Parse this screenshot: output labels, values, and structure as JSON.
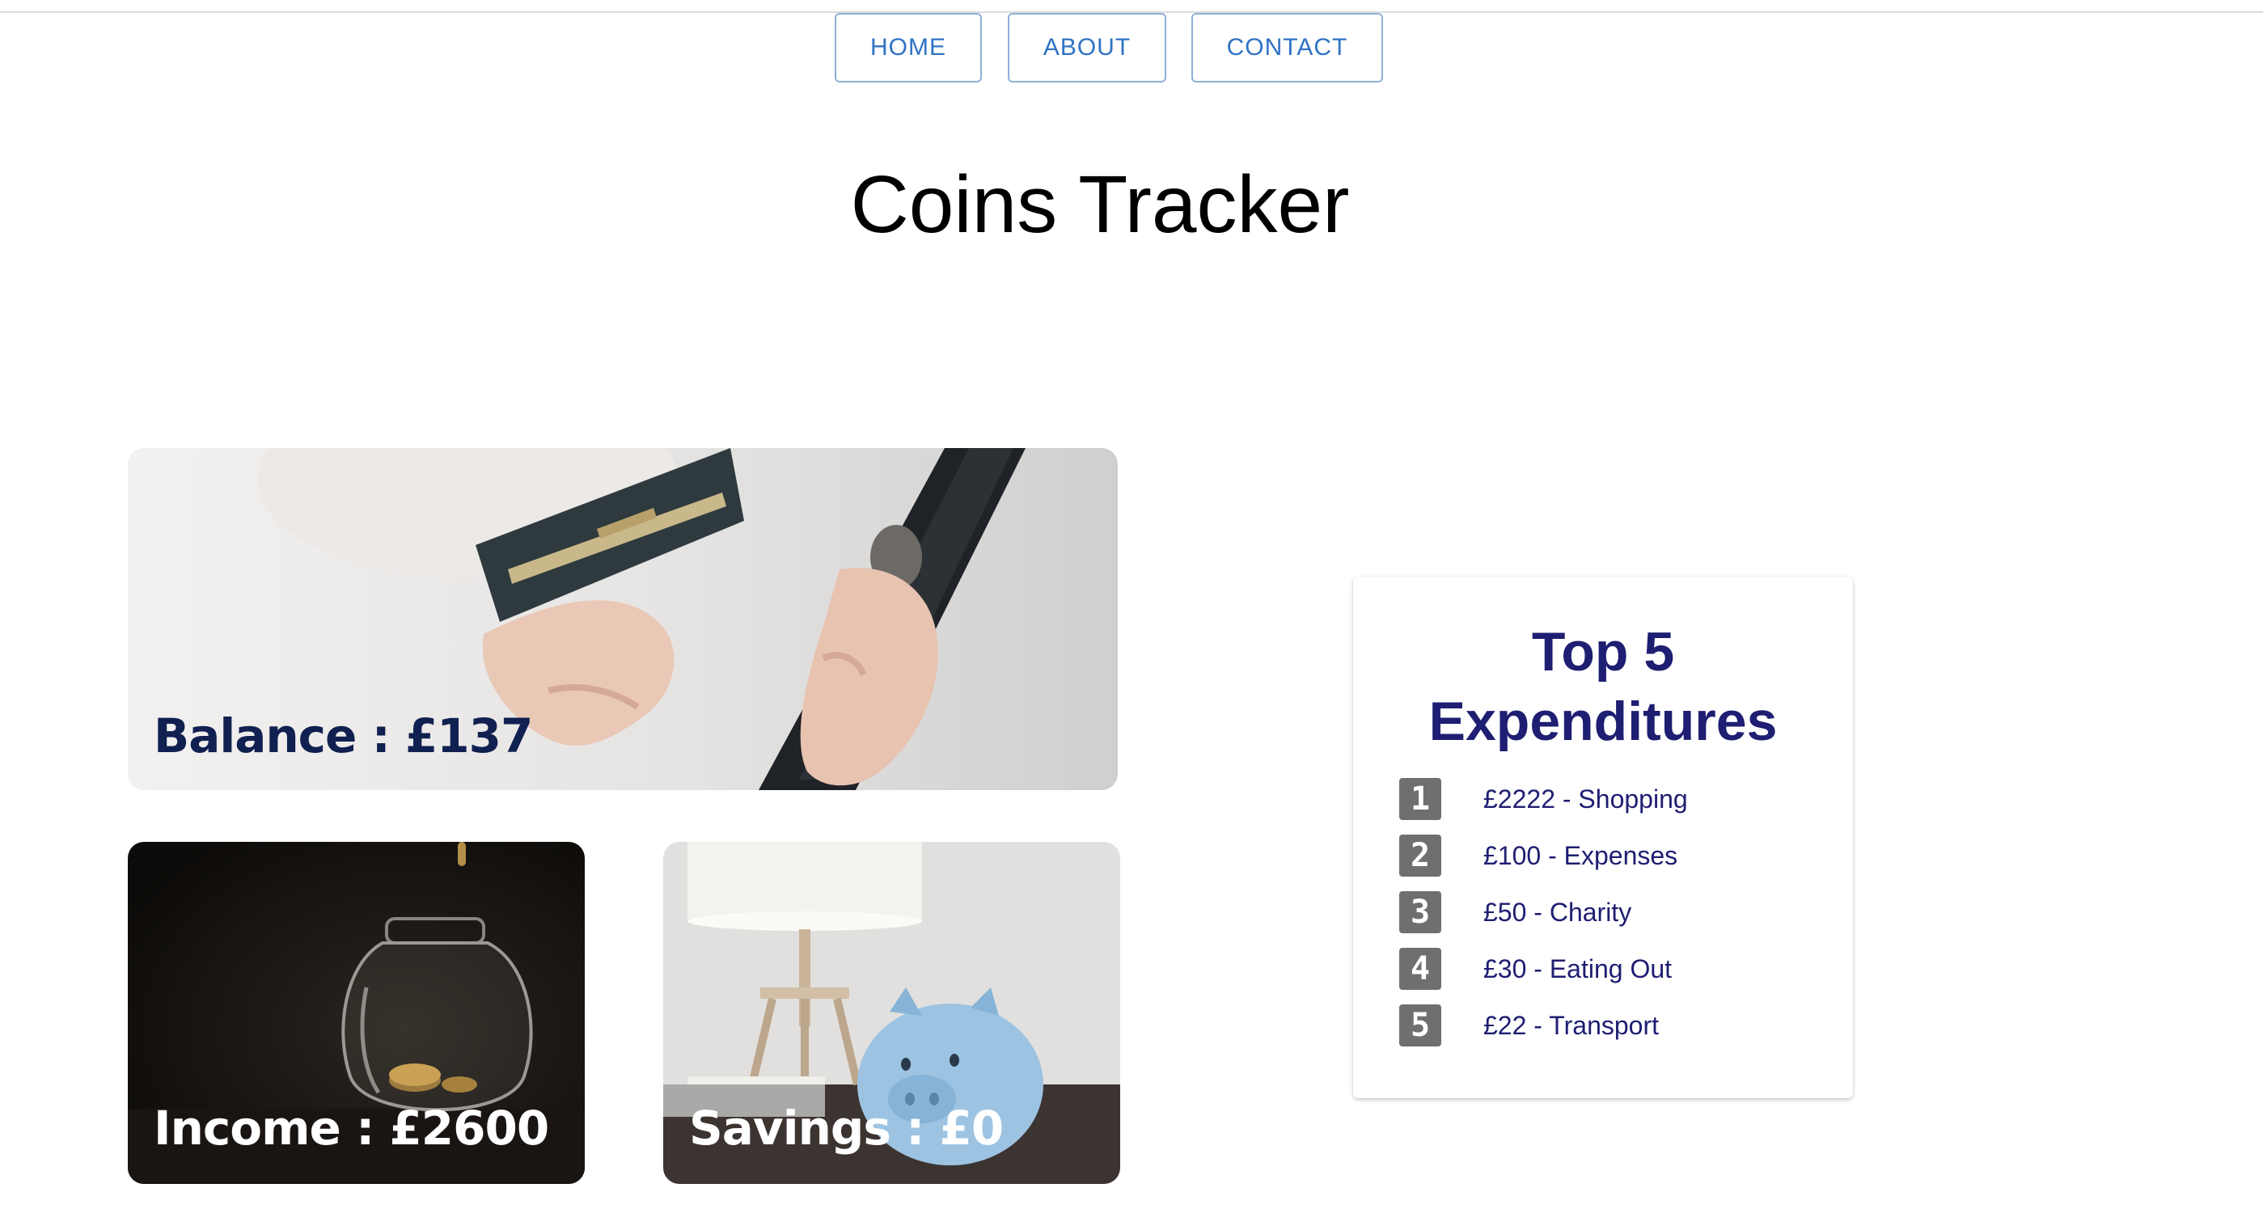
{
  "nav": {
    "home": "HOME",
    "about": "ABOUT",
    "contact": "CONTACT"
  },
  "page": {
    "title": "Coins Tracker"
  },
  "cards": {
    "balance": "Balance : £137",
    "income": "Income : £2600",
    "savings": "Savings : £0"
  },
  "top5": {
    "title_line1": "Top 5",
    "title_line2": "Expenditures",
    "items": [
      {
        "rank": "1",
        "text": "£2222 - Shopping"
      },
      {
        "rank": "2",
        "text": "£100 - Expenses"
      },
      {
        "rank": "3",
        "text": "£50 - Charity"
      },
      {
        "rank": "4",
        "text": "£30 - Eating Out"
      },
      {
        "rank": "5",
        "text": "£22 - Transport"
      }
    ]
  },
  "colors": {
    "nav_accent": "#2f72c4",
    "heading_navy": "#1e1e72",
    "rank_badge": "#6f6f6f"
  }
}
